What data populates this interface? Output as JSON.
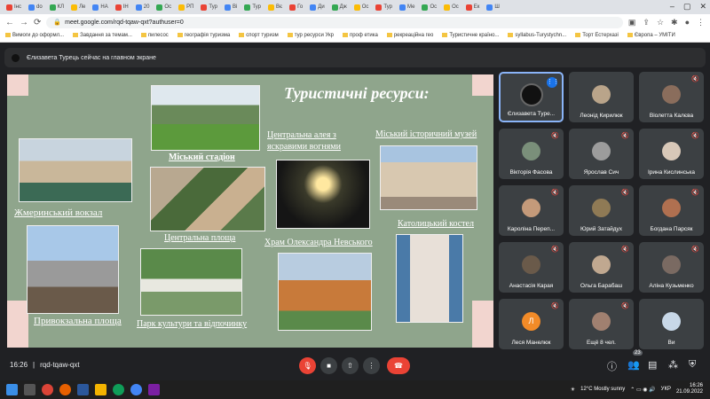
{
  "browser": {
    "tabs": [
      "Інс",
      "do",
      "КЛ",
      "Ле",
      "НА",
      "ІН",
      "20",
      "Ос",
      "РП",
      "Тур",
      "Ві",
      "Тур",
      "Вє",
      "Го",
      "Ди",
      "Дж",
      "Ос",
      "Тур",
      "Ме",
      "Ос",
      "Ос",
      "Ек",
      "Ш"
    ],
    "active_tab": "",
    "url": "meet.google.com/rqd-tqaw-qxt?authuser=0",
    "bookmarks": [
      "Вимоги до оформл...",
      "Завдання за темам...",
      "пилесос",
      "географія туризма",
      "спорт туризм",
      "тур ресурси Укр",
      "проф етика",
      "рекреаційна гео",
      "Туристичне країно...",
      "syllabus-Turystychn...",
      "Торт Естерхазі",
      "Європа – УМІТИ"
    ]
  },
  "banner": {
    "text": "Єлизавета Турець сейчас на главном экране"
  },
  "slide": {
    "title": "Туристичні ресурси:",
    "captions": {
      "stadium": "Міський стадіон",
      "alley": "Центральна алея з яскравими вогнями",
      "museum": "Міський історичний музей",
      "station": "Жмеринський вокзал",
      "square": "Центральна площа",
      "temple": "Храм Олександра Невського",
      "church": "Католицький костел",
      "station_square": "Привокзальна площа",
      "park": "Парк культури та відпочинку"
    }
  },
  "participants": [
    {
      "name": "Єлизавета Туре...",
      "color": "#111111"
    },
    {
      "name": "Леонід Кирилюк",
      "color": "#b9a48a"
    },
    {
      "name": "Віолетта Калєва",
      "color": "#8a6d5c"
    },
    {
      "name": "Вікторія Фасова",
      "color": "#7a8f7a"
    },
    {
      "name": "Ярослав Сич",
      "color": "#9c9c9c"
    },
    {
      "name": "Ірина Кислинська",
      "color": "#d8c8b8"
    },
    {
      "name": "Кароліна Переп...",
      "color": "#c49a7a"
    },
    {
      "name": "Юрий Затайдух",
      "color": "#8f7a55"
    },
    {
      "name": "Богдана Парсяк",
      "color": "#b07050"
    },
    {
      "name": "Анастасія Карая",
      "color": "#6a5a4a"
    },
    {
      "name": "Ольга Барабаш",
      "color": "#c0a890"
    },
    {
      "name": "Аліна Кузьменко",
      "color": "#7a6a62"
    },
    {
      "name": "Леся Манелюк",
      "color": "#f28b28",
      "initial": "Л"
    },
    {
      "name": "Ещё 8 чел.",
      "color": "#a08070"
    },
    {
      "name": "Ви",
      "color": "#c8d8e8"
    }
  ],
  "meeting": {
    "time": "16:26",
    "code": "rqd-tqaw-qxt",
    "participants_count": "23"
  },
  "taskbar": {
    "weather": "12°C  Mostly sunny",
    "lang": "УКР",
    "time": "16:26",
    "date": "21.09.2022"
  }
}
